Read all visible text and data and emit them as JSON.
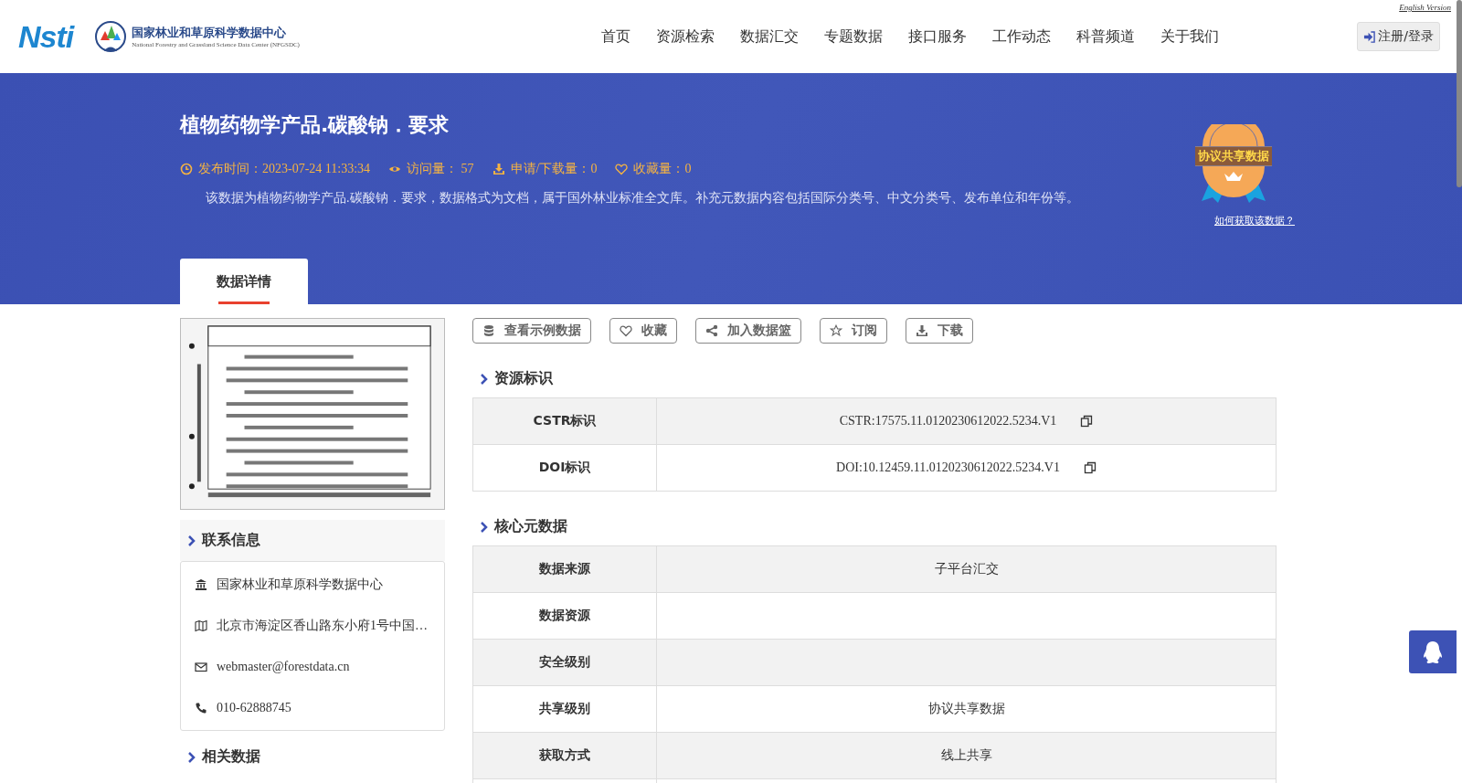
{
  "header": {
    "english_link": "English Version",
    "logo_text": "Nsti",
    "org_name": "国家林业和草原科学数据中心",
    "org_name_en": "National Forestry and Grassland Science Data Center (NFGSDC)",
    "nav": [
      {
        "label": "首页",
        "selected": false
      },
      {
        "label": "资源检索",
        "selected": false
      },
      {
        "label": "数据汇交",
        "selected": false
      },
      {
        "label": "专题数据",
        "selected": false
      },
      {
        "label": "接口服务",
        "selected": false
      },
      {
        "label": "工作动态",
        "selected": false
      },
      {
        "label": "科普频道",
        "selected": false
      },
      {
        "label": "关于我们",
        "selected": false
      }
    ],
    "login_button": "注册/登录"
  },
  "banner": {
    "title": "植物药物学产品.碳酸钠．要求",
    "meta": [
      {
        "kind": "clock",
        "text": "发布时间：2023-07-24 11:33:34"
      },
      {
        "kind": "eye",
        "text": "访问量： 57"
      },
      {
        "kind": "download",
        "text": "申请/下载量：0"
      },
      {
        "kind": "heart",
        "text": "收藏量：0"
      }
    ],
    "description": "该数据为植物药物学产品.碳酸钠．要求，数据格式为文档，属于国外林业标准全文库。补充元数据内容包括国际分类号、中文分类号、发布单位和年份等。",
    "badge_text": "协议共享数据",
    "badge_link": "如何获取该数据？"
  },
  "tabs": [
    {
      "label": "数据详情",
      "selected": true
    }
  ],
  "contact": {
    "title": "联系信息",
    "items": [
      {
        "kind": "org",
        "text": "国家林业和草原科学数据中心"
      },
      {
        "kind": "address",
        "text": "北京市海淀区香山路东小府1号中国…"
      },
      {
        "kind": "email",
        "text": "webmaster@forestdata.cn"
      },
      {
        "kind": "phone",
        "text": "010-62888745"
      }
    ]
  },
  "related": {
    "title": "相关数据"
  },
  "actions": [
    {
      "kind": "database",
      "label": "查看示例数据"
    },
    {
      "kind": "heart",
      "label": "收藏"
    },
    {
      "kind": "share",
      "label": "加入数据篮"
    },
    {
      "kind": "star",
      "label": "订阅"
    },
    {
      "kind": "download",
      "label": "下载"
    }
  ],
  "identifiers": {
    "title": "资源标识",
    "rows": [
      {
        "label": "CSTR标识",
        "value": "CSTR:17575.11.0120230612022.5234.V1",
        "copy": true
      },
      {
        "label": "DOI标识",
        "value": "DOI:10.12459.11.0120230612022.5234.V1",
        "copy": true
      }
    ]
  },
  "core_metadata": {
    "title": "核心元数据",
    "rows": [
      {
        "label": "数据来源",
        "value": "子平台汇交"
      },
      {
        "label": "数据资源"
      },
      {
        "label": "安全级别"
      },
      {
        "label": "共享级别",
        "value": "协议共享数据"
      },
      {
        "label": "获取方式",
        "value": "线上共享"
      }
    ]
  }
}
